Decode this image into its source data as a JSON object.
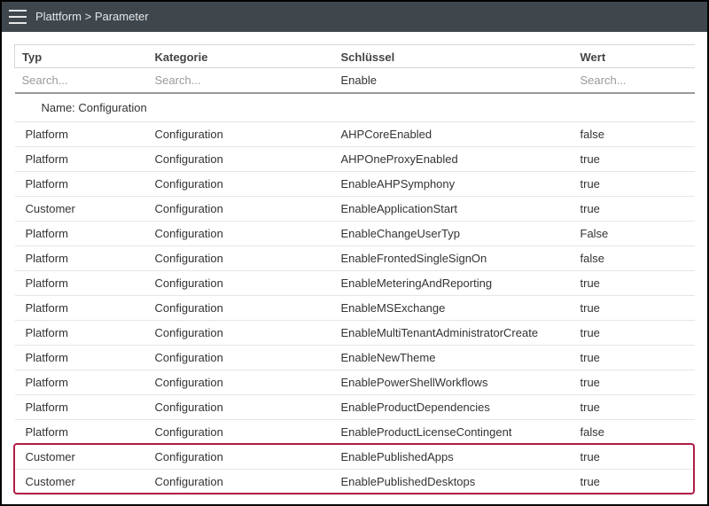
{
  "breadcrumb": "Plattform > Parameter",
  "columns": {
    "typ": "Typ",
    "kategorie": "Kategorie",
    "schluessel": "Schlüssel",
    "wert": "Wert"
  },
  "search": {
    "placeholder": "Search...",
    "typ_value": "",
    "kategorie_value": "",
    "schluessel_value": "Enable",
    "wert_value": ""
  },
  "group_label": "Name: Configuration",
  "rows": [
    {
      "typ": "Platform",
      "kategorie": "Configuration",
      "schluessel": "AHPCoreEnabled",
      "wert": "false"
    },
    {
      "typ": "Platform",
      "kategorie": "Configuration",
      "schluessel": "AHPOneProxyEnabled",
      "wert": "true"
    },
    {
      "typ": "Platform",
      "kategorie": "Configuration",
      "schluessel": "EnableAHPSymphony",
      "wert": "true"
    },
    {
      "typ": "Customer",
      "kategorie": "Configuration",
      "schluessel": "EnableApplicationStart",
      "wert": "true"
    },
    {
      "typ": "Platform",
      "kategorie": "Configuration",
      "schluessel": "EnableChangeUserTyp",
      "wert": "False"
    },
    {
      "typ": "Platform",
      "kategorie": "Configuration",
      "schluessel": "EnableFrontedSingleSignOn",
      "wert": "false"
    },
    {
      "typ": "Platform",
      "kategorie": "Configuration",
      "schluessel": "EnableMeteringAndReporting",
      "wert": "true"
    },
    {
      "typ": "Platform",
      "kategorie": "Configuration",
      "schluessel": "EnableMSExchange",
      "wert": "true"
    },
    {
      "typ": "Platform",
      "kategorie": "Configuration",
      "schluessel": "EnableMultiTenantAdministratorCreate",
      "wert": "true"
    },
    {
      "typ": "Platform",
      "kategorie": "Configuration",
      "schluessel": "EnableNewTheme",
      "wert": "true"
    },
    {
      "typ": "Platform",
      "kategorie": "Configuration",
      "schluessel": "EnablePowerShellWorkflows",
      "wert": "true"
    },
    {
      "typ": "Platform",
      "kategorie": "Configuration",
      "schluessel": "EnableProductDependencies",
      "wert": "true"
    },
    {
      "typ": "Platform",
      "kategorie": "Configuration",
      "schluessel": "EnableProductLicenseContingent",
      "wert": "false"
    },
    {
      "typ": "Customer",
      "kategorie": "Configuration",
      "schluessel": "EnablePublishedApps",
      "wert": "true"
    },
    {
      "typ": "Customer",
      "kategorie": "Configuration",
      "schluessel": "EnablePublishedDesktops",
      "wert": "true"
    }
  ],
  "highlight_start_index": 13,
  "highlight_end_index": 14
}
